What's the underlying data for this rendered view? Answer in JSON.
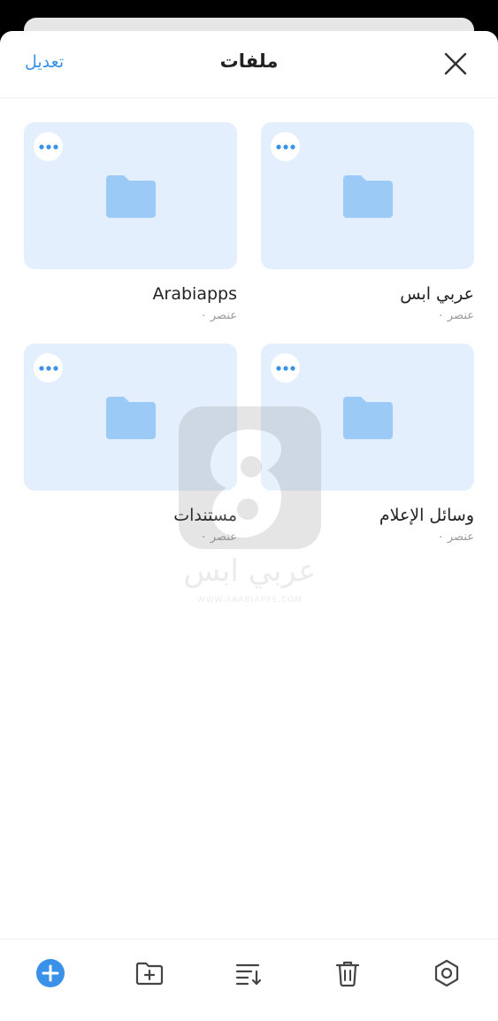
{
  "header": {
    "title": "ملفات",
    "edit_label": "تعديل"
  },
  "folders": [
    {
      "name": "عربي ابس",
      "count": "عنصر ٠"
    },
    {
      "name": "Arabiapps",
      "count": "عنصر ٠"
    },
    {
      "name": "وسائل الإعلام",
      "count": "عنصر ٠"
    },
    {
      "name": "مستندات",
      "count": "عنصر ٠"
    }
  ],
  "watermark": {
    "text": "عربي ابس",
    "sub": "WWW.ARABIAPPS.COM"
  },
  "colors": {
    "accent": "#3a92e8",
    "folder_bg": "#e3effc",
    "folder_icon": "#9ccaf7"
  },
  "toolbar": {
    "icons": [
      "add-icon",
      "new-folder-icon",
      "sort-icon",
      "trash-icon",
      "settings-icon"
    ]
  }
}
